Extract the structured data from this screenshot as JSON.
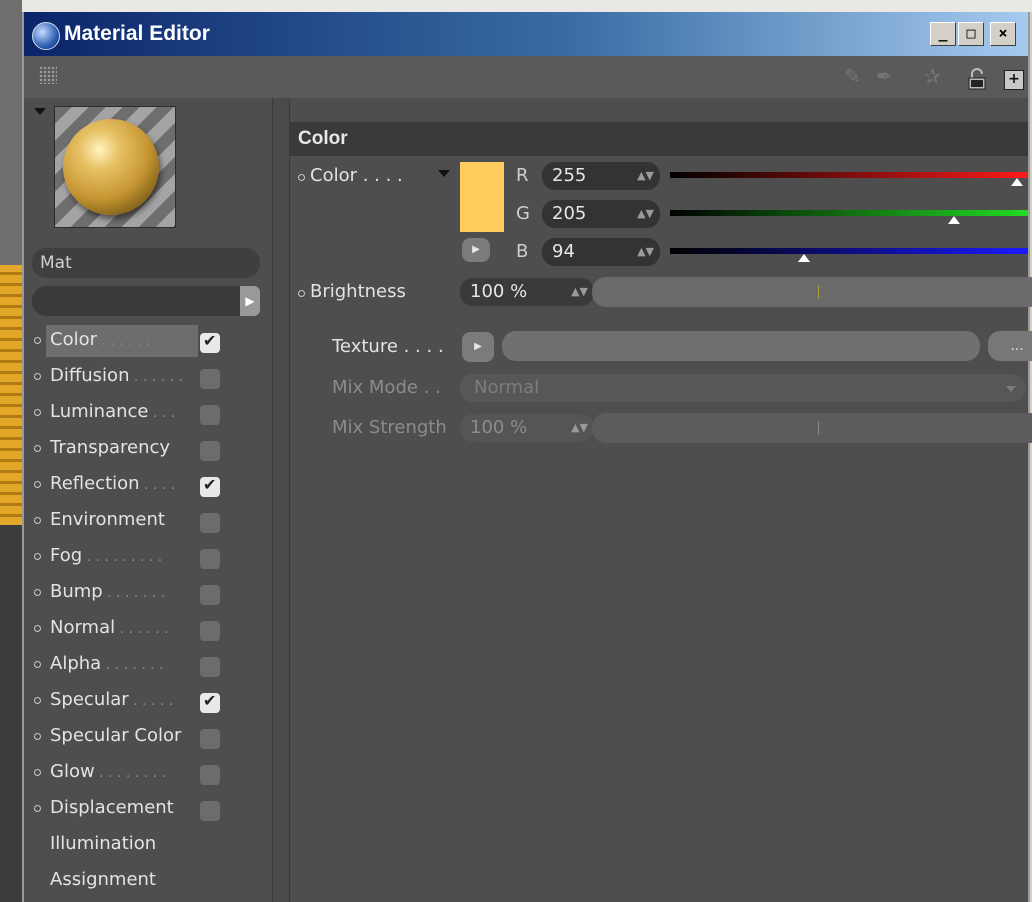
{
  "window": {
    "title": "Material Editor",
    "controls": {
      "minimize": "_",
      "maximize": "□",
      "close": "×"
    }
  },
  "toolbar": {
    "icons": [
      "grip-icon",
      "brush-icon",
      "pen-icon",
      "pin-icon",
      "lock-icon",
      "new-window-icon"
    ]
  },
  "material": {
    "name": "Mat",
    "field_value": ""
  },
  "channels": [
    {
      "label": "Color",
      "dots": " . . . . . .",
      "checked": true,
      "selected": true
    },
    {
      "label": "Diffusion",
      "dots": " . . . . . .",
      "checked": false
    },
    {
      "label": "Luminance",
      "dots": " . . .",
      "checked": false
    },
    {
      "label": "Transparency",
      "dots": "",
      "checked": false
    },
    {
      "label": "Reflection",
      "dots": " . . . .",
      "checked": true
    },
    {
      "label": "Environment",
      "dots": "",
      "checked": false
    },
    {
      "label": "Fog",
      "dots": " . . . . . . . . .",
      "checked": false
    },
    {
      "label": "Bump",
      "dots": " . . . . . . .",
      "checked": false
    },
    {
      "label": "Normal",
      "dots": " . . . . . .",
      "checked": false
    },
    {
      "label": "Alpha",
      "dots": " . . . . . . .",
      "checked": false
    },
    {
      "label": "Specular",
      "dots": " . . . . .",
      "checked": true
    },
    {
      "label": "Specular Color",
      "dots": "",
      "checked": false
    },
    {
      "label": "Glow",
      "dots": " . . . . . . . .",
      "checked": false
    },
    {
      "label": "Displacement",
      "dots": "",
      "checked": false
    },
    {
      "label": "Illumination",
      "plain": true
    },
    {
      "label": "Assignment",
      "plain": true
    }
  ],
  "section": {
    "title": "Color"
  },
  "color": {
    "label": "Color . . . .",
    "swatch": "#ffcd5e",
    "r_label": "R",
    "r": "255",
    "r_fraction": 1.0,
    "g_label": "G",
    "g": "205",
    "g_fraction": 0.804,
    "b_label": "B",
    "b": "94",
    "b_fraction": 0.369,
    "brightness_label": "Brightness",
    "brightness": "100 %",
    "brightness_fraction": 1.0
  },
  "texture": {
    "label": "Texture . . . .",
    "browse": "...",
    "mix_mode_label": "Mix Mode . .",
    "mix_mode": "Normal",
    "mix_strength_label": "Mix Strength",
    "mix_strength": "100 %"
  }
}
